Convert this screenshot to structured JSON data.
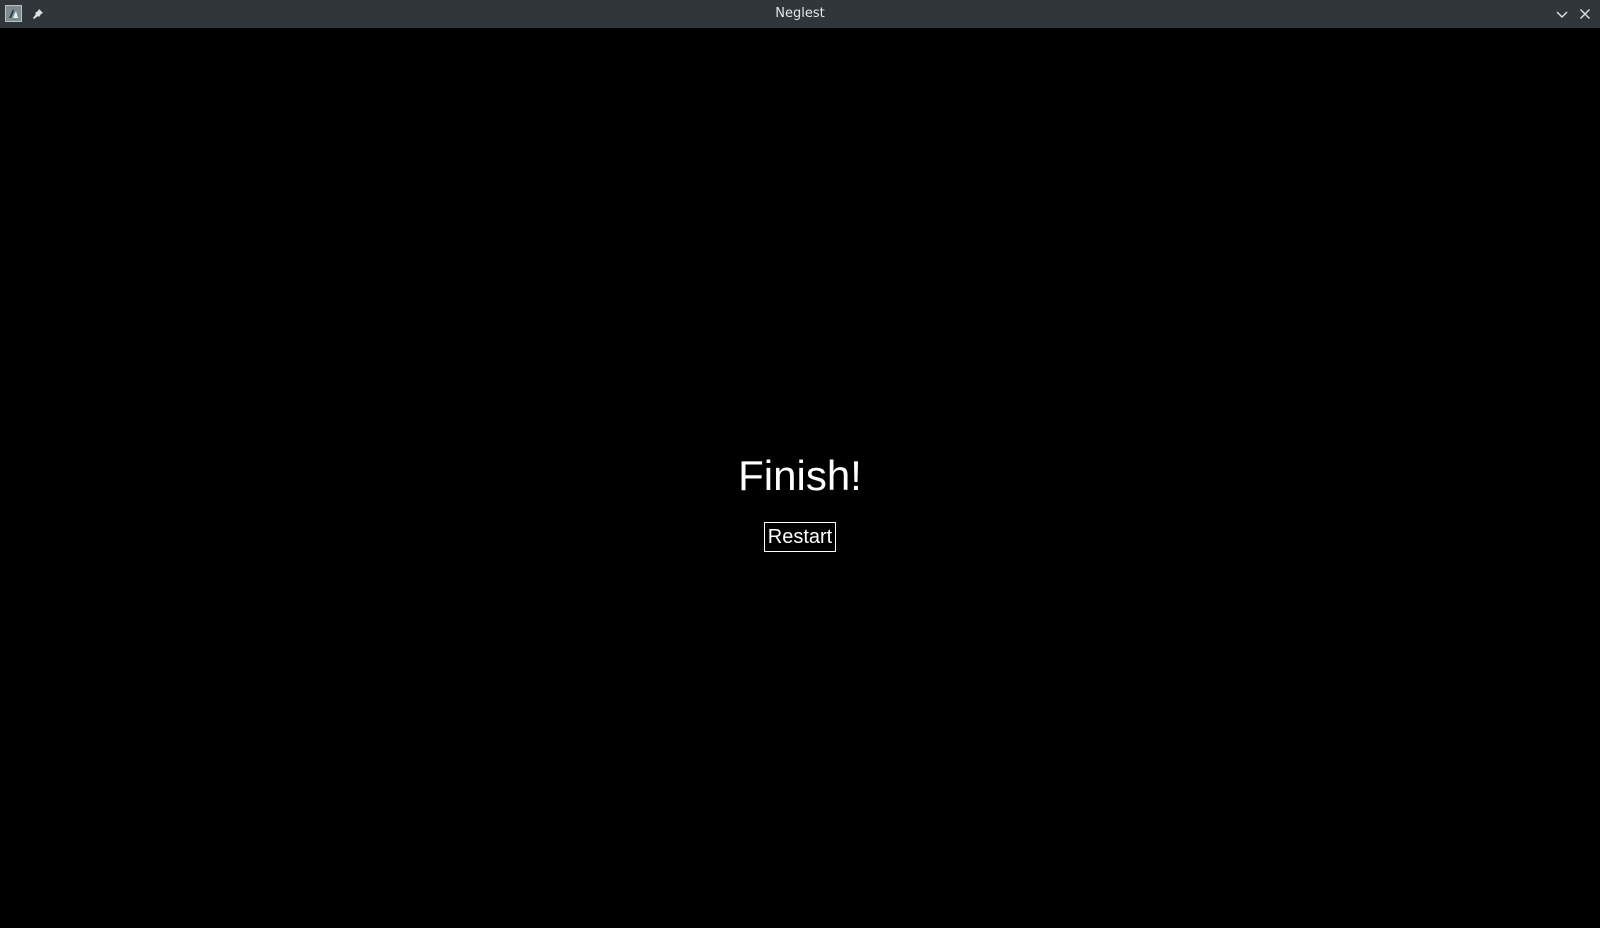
{
  "window": {
    "title": "Neglest",
    "icons": {
      "app": "app-icon",
      "pin": "pin-icon",
      "minimize": "chevron-down-icon",
      "close": "close-icon"
    }
  },
  "game": {
    "message": "Finish!",
    "restart_label": "Restart"
  },
  "colors": {
    "titlebar": "#31363b",
    "background": "#000000",
    "text": "#ffffff"
  }
}
